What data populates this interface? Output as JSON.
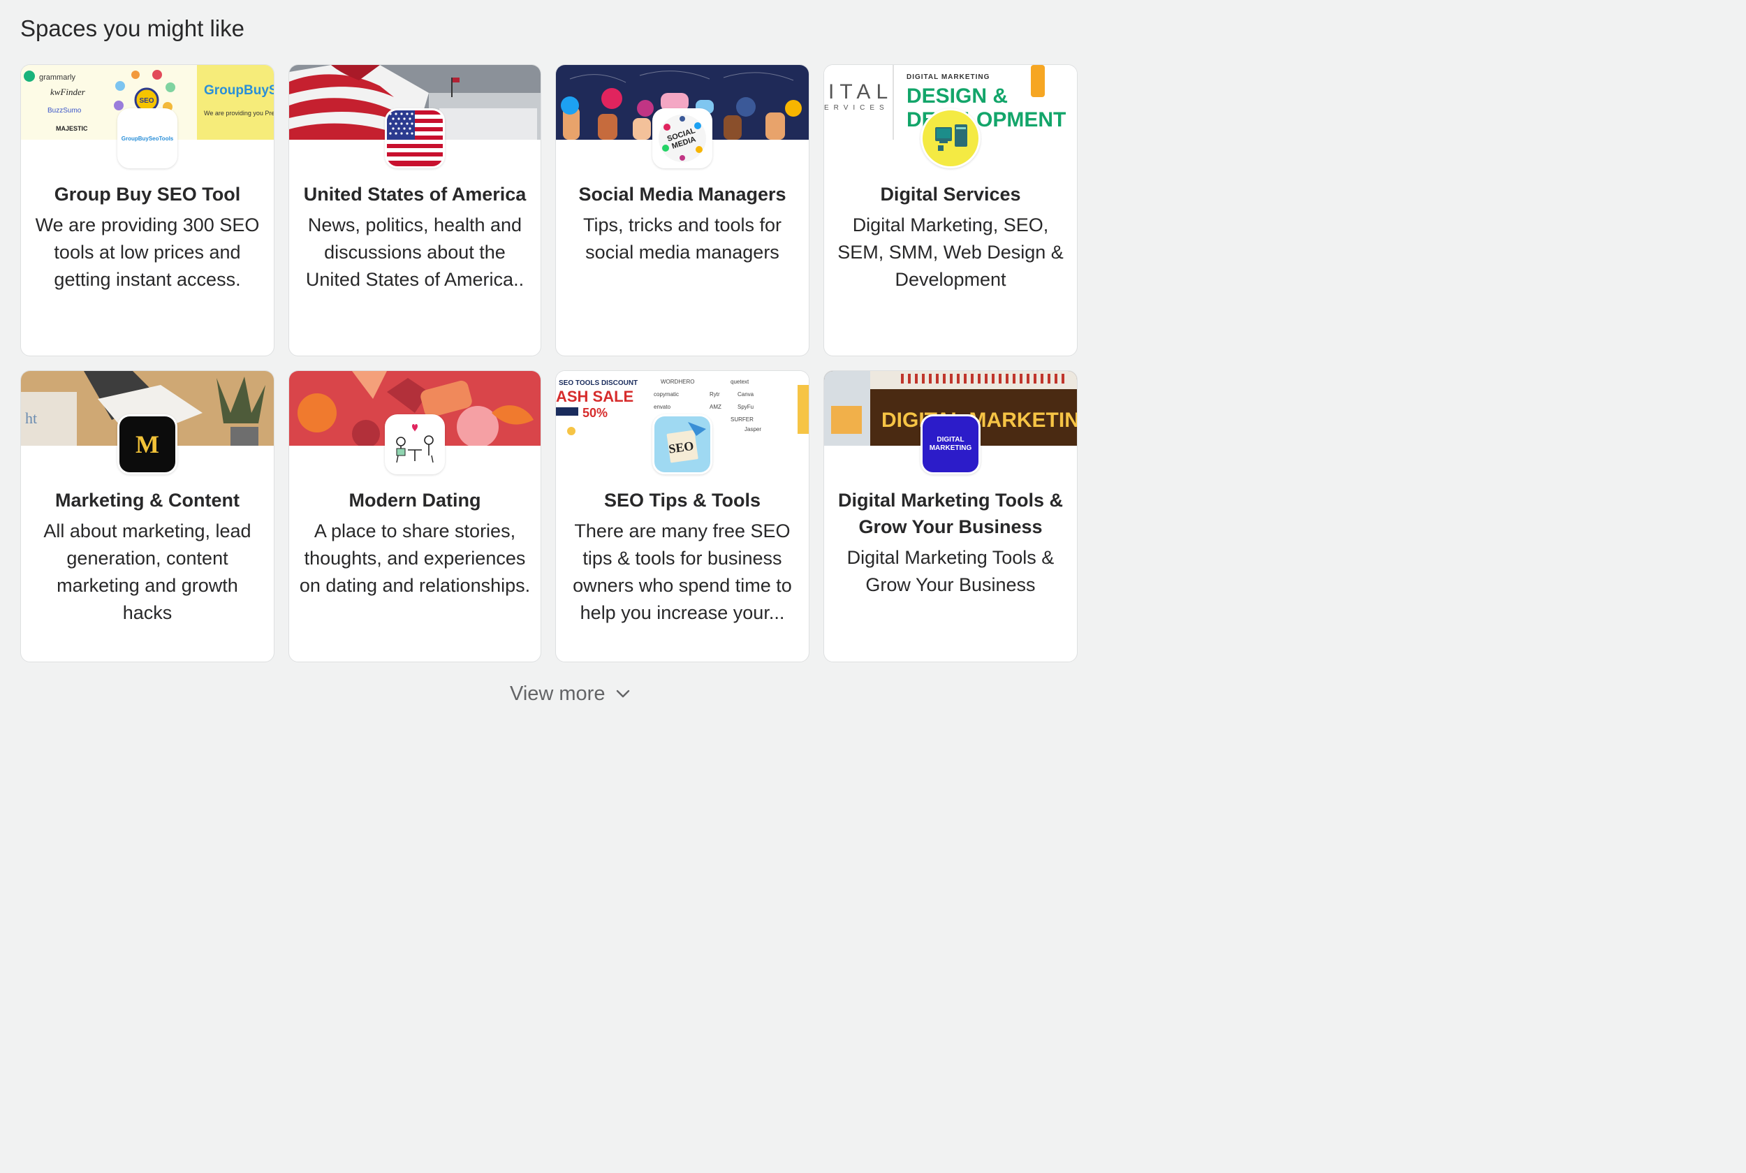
{
  "section": {
    "title": "Spaces you might like"
  },
  "cards": [
    {
      "title": "Group Buy SEO Tool",
      "description": "We are providing 300 SEO tools at low prices and getting instant access.",
      "cover_text": "GroupBuyS",
      "cover_sub": "We are providing you Premium tools in a ve",
      "cover_logos": [
        "grammarly",
        "kwFinder",
        "BuzzSumo",
        "MAJESTIC",
        "SEO"
      ],
      "avatar_text": "GroupBuySeoTools",
      "accent": "#f7f08a"
    },
    {
      "title": "United States of America",
      "description": "News, politics, health and discussions about the United States of America..",
      "avatar_icon": "us-flag-icon",
      "accent": "#b22234"
    },
    {
      "title": "Social Media Managers",
      "description": "Tips, tricks and tools for social media managers",
      "avatar_text": "SOCIAL MEDIA",
      "accent": "#1e2a5a"
    },
    {
      "title": "Digital Services",
      "description": "Digital Marketing, SEO, SEM, SMM, Web Design & Development",
      "cover_kicker": "DIGITAL MARKETING",
      "cover_line1": "DESIGN &",
      "cover_line2": "DEVELOPMENT",
      "cover_left": "ITAL",
      "cover_left_sub": "ERVICES",
      "accent": "#f5e13c"
    },
    {
      "title": "Marketing & Content",
      "description": "All about marketing, lead generation, content marketing and growth hacks",
      "avatar_text": "M",
      "accent": "#d6a05a"
    },
    {
      "title": "Modern Dating",
      "description": "A place to share stories, thoughts, and experiences on dating and relationships.",
      "accent": "#d9454a"
    },
    {
      "title": "SEO Tips & Tools",
      "description": "There are many free SEO tips & tools for business owners who spend time to help you increase your...",
      "cover_kicker": "SEO TOOLS DISCOUNT",
      "cover_sale": "ASH SALE",
      "cover_pct": "50%",
      "avatar_text": "SEO",
      "accent": "#8fd0ee"
    },
    {
      "title": "Digital Marketing Tools & Grow Your Business",
      "description": "Digital Marketing Tools & Grow Your Business",
      "cover_text": "DIGITAL MARKETIN",
      "avatar_text": "DIGITAL MARKETING",
      "accent": "#2c1cc9"
    }
  ],
  "view_more": {
    "label": "View more"
  }
}
